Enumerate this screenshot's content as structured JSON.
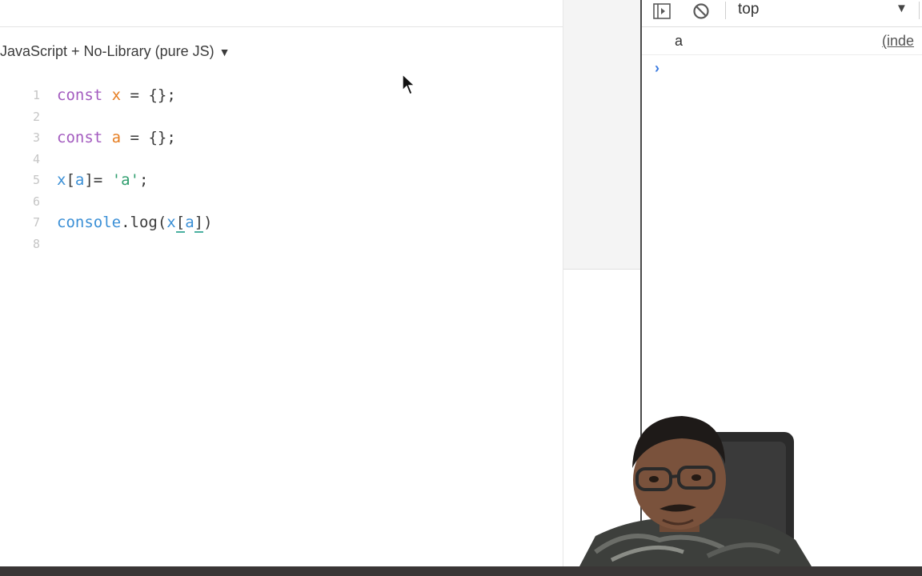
{
  "editor": {
    "language_select": "JavaScript + No-Library (pure JS)",
    "lines": [
      {
        "num": "1",
        "tokens": [
          {
            "t": "const",
            "c": "kw"
          },
          {
            "t": " "
          },
          {
            "t": "x",
            "c": "var-o"
          },
          {
            "t": " = ",
            "c": "pun"
          },
          {
            "t": "{};",
            "c": "pun"
          }
        ]
      },
      {
        "num": "2",
        "tokens": []
      },
      {
        "num": "3",
        "tokens": [
          {
            "t": "const",
            "c": "kw"
          },
          {
            "t": " "
          },
          {
            "t": "a",
            "c": "var-o"
          },
          {
            "t": " = ",
            "c": "pun"
          },
          {
            "t": "{};",
            "c": "pun"
          }
        ]
      },
      {
        "num": "4",
        "tokens": []
      },
      {
        "num": "5",
        "tokens": [
          {
            "t": "x",
            "c": "var-b"
          },
          {
            "t": "[",
            "c": "pun"
          },
          {
            "t": "a",
            "c": "var-b"
          },
          {
            "t": "]= ",
            "c": "pun"
          },
          {
            "t": "'a'",
            "c": "str"
          },
          {
            "t": ";",
            "c": "pun"
          }
        ]
      },
      {
        "num": "6",
        "tokens": []
      },
      {
        "num": "7",
        "tokens": [
          {
            "t": "console",
            "c": "var-b"
          },
          {
            "t": ".log(",
            "c": "pun"
          },
          {
            "t": "x",
            "c": "var-b"
          },
          {
            "t": "[",
            "c": "pun hl"
          },
          {
            "t": "a",
            "c": "var-b"
          },
          {
            "t": "]",
            "c": "pun hl"
          },
          {
            "t": ")",
            "c": "pun"
          }
        ]
      },
      {
        "num": "8",
        "tokens": []
      }
    ]
  },
  "devtools": {
    "context": "top",
    "log": {
      "message": "a",
      "source": "(inde"
    },
    "prompt": "›"
  },
  "colors": {
    "keyword": "#a35bbf",
    "variable_decl": "#e67e22",
    "identifier": "#3a8fd6",
    "string": "#2f9e6e",
    "prompt": "#3b7be0"
  },
  "icons": [
    "sidebar-toggle-icon",
    "clear-console-icon",
    "dropdown-caret-icon",
    "mouse-cursor-icon"
  ]
}
